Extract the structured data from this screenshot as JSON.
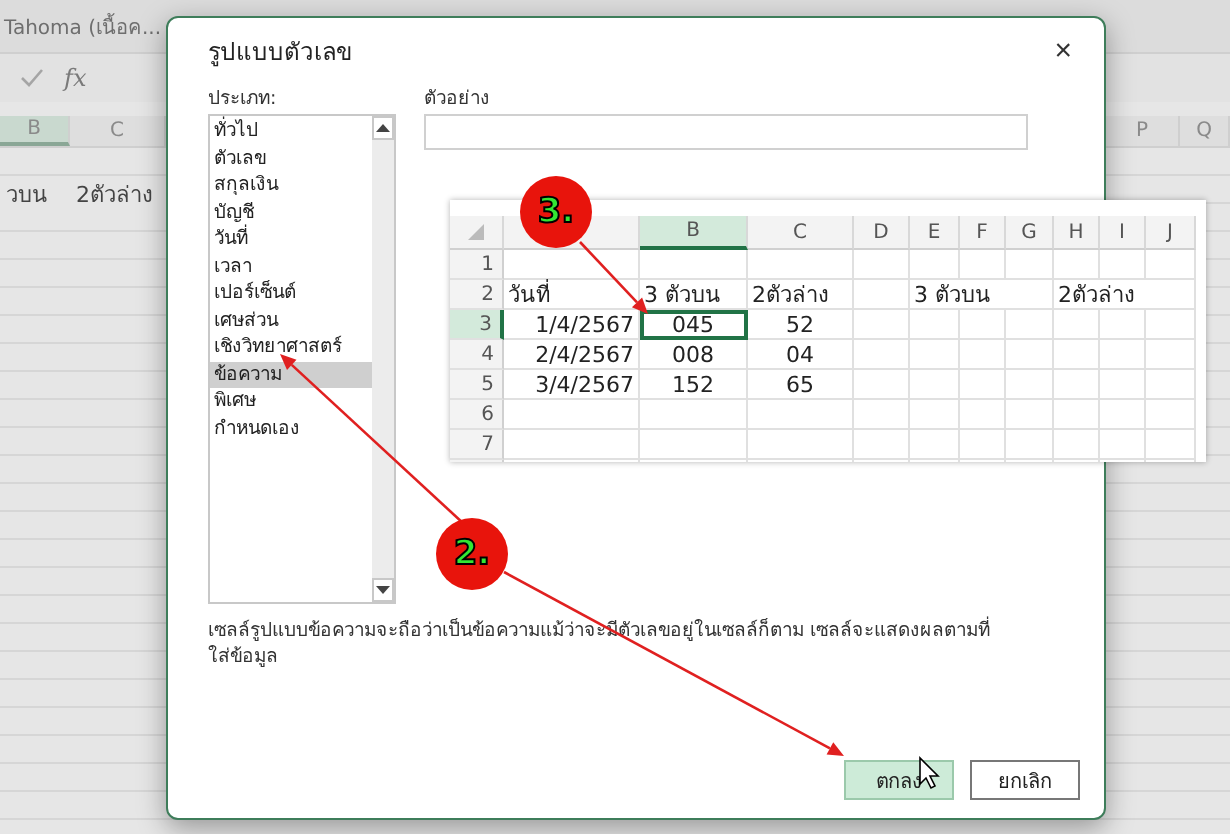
{
  "ribbon": {
    "font_name": "Tahoma (เนื้อค..."
  },
  "formula_bar": {
    "function_label": "fx"
  },
  "background_sheet": {
    "columns_left": [
      {
        "label": "B",
        "selected": true
      },
      {
        "label": "C",
        "selected": false
      }
    ],
    "columns_right": [
      {
        "label": "P",
        "selected": false
      },
      {
        "label": "Q",
        "selected": false
      }
    ],
    "row_2": [
      "วบน",
      "2ตัวล่าง"
    ]
  },
  "dialog": {
    "title": "รูปแบบตัวเลข",
    "close": "×",
    "category_label": "ประเภท:",
    "categories": [
      {
        "label": "ทั่วไป",
        "selected": false
      },
      {
        "label": "ตัวเลข",
        "selected": false
      },
      {
        "label": "สกุลเงิน",
        "selected": false
      },
      {
        "label": "บัญชี",
        "selected": false
      },
      {
        "label": "วันที่",
        "selected": false
      },
      {
        "label": "เวลา",
        "selected": false
      },
      {
        "label": "เปอร์เซ็นต์",
        "selected": false
      },
      {
        "label": "เศษส่วน",
        "selected": false
      },
      {
        "label": "เชิงวิทยาศาสตร์",
        "selected": false
      },
      {
        "label": "ข้อความ",
        "selected": true
      },
      {
        "label": "พิเศษ",
        "selected": false
      },
      {
        "label": "กำหนดเอง",
        "selected": false
      }
    ],
    "sample_label": "ตัวอย่าง",
    "description": "เซลล์รูปแบบข้อความจะถือว่าเป็นข้อความแม้ว่าจะมีตัวเลขอยู่ในเซลล์ก็ตาม เซลล์จะแสดงผลตามที่ใส่ข้อมูล",
    "buttons": [
      {
        "label": "ตกลง",
        "kind": "primary"
      },
      {
        "label": "ยกเลิก",
        "kind": "secondary"
      }
    ]
  },
  "inset_sheet": {
    "columns": [
      {
        "selected": false
      },
      {
        "label": "B",
        "selected": true
      },
      {
        "label": "C",
        "selected": false
      },
      {
        "label": "D",
        "selected": false
      },
      {
        "label": "E",
        "selected": false
      },
      {
        "label": "F",
        "selected": false
      },
      {
        "label": "G",
        "selected": false
      },
      {
        "label": "H",
        "selected": false
      },
      {
        "label": "I",
        "selected": false
      },
      {
        "label": "J",
        "selected": false
      }
    ],
    "rows": [
      {
        "number": "1",
        "selected": false,
        "cells": [
          null,
          null,
          null,
          null,
          null,
          null,
          null,
          null,
          null,
          null
        ]
      },
      {
        "number": "2",
        "selected": false,
        "cells": [
          "วันที่",
          "3 ตัวบน",
          "2ตัวล่าง",
          null,
          "3 ตัวบน",
          null,
          null,
          "2ตัวล่าง",
          null,
          null
        ]
      },
      {
        "number": "3",
        "selected": true,
        "cells": [
          "1/4/2567",
          "045",
          "52",
          null,
          null,
          null,
          null,
          null,
          null,
          null
        ]
      },
      {
        "number": "4",
        "selected": false,
        "cells": [
          "2/4/2567",
          "008",
          "04",
          null,
          null,
          null,
          null,
          null,
          null,
          null
        ]
      },
      {
        "number": "5",
        "selected": false,
        "cells": [
          "3/4/2567",
          "152",
          "65",
          null,
          null,
          null,
          null,
          null,
          null,
          null
        ]
      },
      {
        "number": "6",
        "selected": false,
        "cells": [
          null,
          null,
          null,
          null,
          null,
          null,
          null,
          null,
          null,
          null
        ]
      },
      {
        "number": "7",
        "selected": false,
        "cells": [
          null,
          null,
          null,
          null,
          null,
          null,
          null,
          null,
          null,
          null
        ]
      }
    ]
  },
  "annotations": [
    {
      "label": "3."
    },
    {
      "label": "2."
    }
  ]
}
